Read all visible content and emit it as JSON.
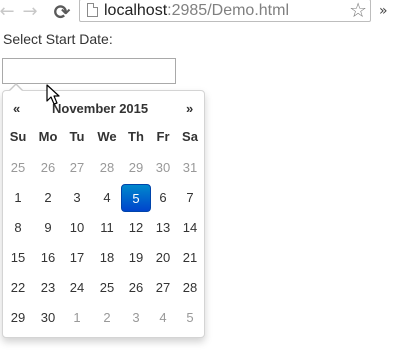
{
  "browser": {
    "back_icon": "arrow-left-icon",
    "forward_icon": "arrow-right-icon",
    "reload_icon": "reload-icon",
    "url_host": "localhost",
    "url_rest": ":2985/Demo.html",
    "menu_glyph": "»"
  },
  "form": {
    "label": "Select Start Date:",
    "input_value": ""
  },
  "datepicker": {
    "prev": "«",
    "title": "November 2015",
    "next": "»",
    "weekdays": [
      "Su",
      "Mo",
      "Tu",
      "We",
      "Th",
      "Fr",
      "Sa"
    ],
    "weeks": [
      [
        {
          "d": "25",
          "muted": true
        },
        {
          "d": "26",
          "muted": true
        },
        {
          "d": "27",
          "muted": true
        },
        {
          "d": "28",
          "muted": true
        },
        {
          "d": "29",
          "muted": true
        },
        {
          "d": "30",
          "muted": true
        },
        {
          "d": "31",
          "muted": true
        }
      ],
      [
        {
          "d": "1"
        },
        {
          "d": "2"
        },
        {
          "d": "3"
        },
        {
          "d": "4"
        },
        {
          "d": "5",
          "active": true
        },
        {
          "d": "6"
        },
        {
          "d": "7"
        }
      ],
      [
        {
          "d": "8"
        },
        {
          "d": "9"
        },
        {
          "d": "10"
        },
        {
          "d": "11"
        },
        {
          "d": "12"
        },
        {
          "d": "13"
        },
        {
          "d": "14"
        }
      ],
      [
        {
          "d": "15"
        },
        {
          "d": "16"
        },
        {
          "d": "17"
        },
        {
          "d": "18"
        },
        {
          "d": "19"
        },
        {
          "d": "20"
        },
        {
          "d": "21"
        }
      ],
      [
        {
          "d": "22"
        },
        {
          "d": "23"
        },
        {
          "d": "24"
        },
        {
          "d": "25"
        },
        {
          "d": "26"
        },
        {
          "d": "27"
        },
        {
          "d": "28"
        }
      ],
      [
        {
          "d": "29"
        },
        {
          "d": "30"
        },
        {
          "d": "1",
          "muted": true
        },
        {
          "d": "2",
          "muted": true
        },
        {
          "d": "3",
          "muted": true
        },
        {
          "d": "4",
          "muted": true
        },
        {
          "d": "5",
          "muted": true
        }
      ]
    ]
  }
}
